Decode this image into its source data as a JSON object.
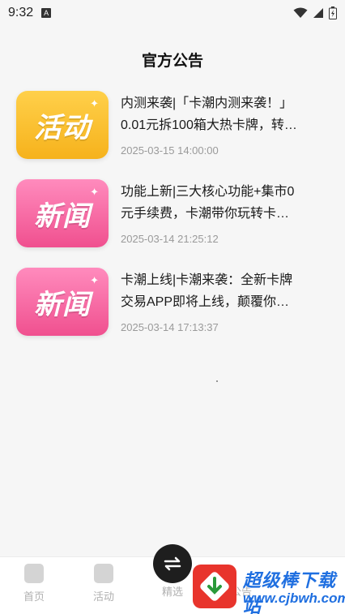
{
  "status_bar": {
    "time": "9:32",
    "notification_icon": "A"
  },
  "header": {
    "title": "官方公告"
  },
  "announcements": [
    {
      "thumb_label": "活动",
      "thumb_type": "activity",
      "line1": "内测来袭|「卡潮内测来袭！」",
      "line2": "0.01元拆100箱大热卡牌，转…",
      "date": "2025-03-15 14:00:00"
    },
    {
      "thumb_label": "新闻",
      "thumb_type": "news",
      "line1": "功能上新|三大核心功能+集市0",
      "line2": "元手续费，卡潮带你玩转卡…",
      "date": "2025-03-14 21:25:12"
    },
    {
      "thumb_label": "新闻",
      "thumb_type": "news",
      "line1": "卡潮上线|卡潮来袭：全新卡牌",
      "line2": "交易APP即将上线，颠覆你…",
      "date": "2025-03-14 17:13:37"
    }
  ],
  "bottom_nav": {
    "items": [
      {
        "label": "首页",
        "icon": "home-icon"
      },
      {
        "label": "活动",
        "icon": "activity-icon"
      },
      {
        "label": "精选",
        "icon": "featured-icon"
      },
      {
        "label": "公告",
        "icon": "announcement-icon"
      }
    ],
    "center_icon": "swap-icon"
  },
  "watermark": {
    "title": "超级棒下载站",
    "url": "www.cjbwh.com"
  },
  "colors": {
    "activity_thumb": "#f6b21c",
    "news_thumb": "#f0508f",
    "watermark_blue": "#1f6fe0"
  }
}
